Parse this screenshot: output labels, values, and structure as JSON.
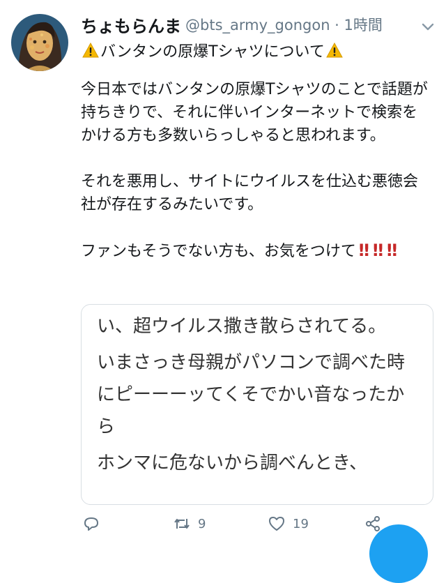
{
  "tweet": {
    "display_name": "ちょもらんま",
    "handle_and_time": "@bts_army_gongon · 1時間",
    "title": "バンタンの原爆Tシャツについて",
    "paragraphs": [
      "今日本ではバンタンの原爆Tシャツのことで話題が持ちきりで、それに伴いインターネットで検索をかける方も多数いらっしゃると思われます。",
      "それを悪用し、サイトにウイルスを仕込む悪徳会社が存在するみたいです。"
    ],
    "closing_text": "ファンもそうでない方も、お気をつけて",
    "bangs": [
      "‼",
      "‼",
      "‼"
    ]
  },
  "quote": {
    "lines": [
      "い、超ウイルス撒き散らされてる。",
      "いまさっき母親がパソコンで調べた時にピーーーッてくそでかい音なったから",
      "ホンマに危ないから調べんとき、"
    ]
  },
  "actions": {
    "retweet_count": "9",
    "like_count": "19"
  },
  "colors": {
    "accent": "#1da1f2",
    "muted": "#657786",
    "warning": "#f5b800",
    "bang": "#c62828"
  }
}
